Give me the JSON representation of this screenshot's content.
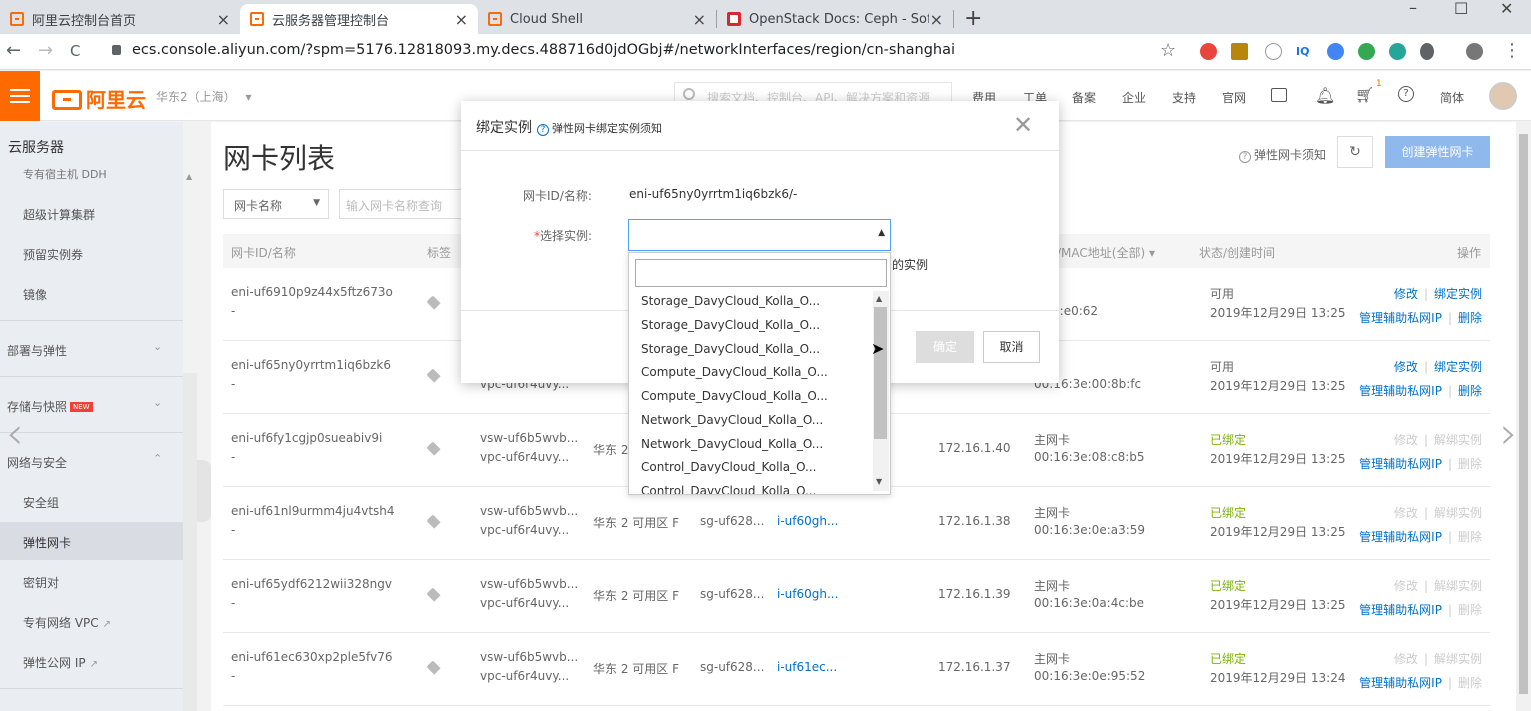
{
  "browser": {
    "tabs": [
      {
        "title": "阿里云控制台首页",
        "close": "×"
      },
      {
        "title": "云服务器管理控制台",
        "close": "×"
      },
      {
        "title": "Cloud Shell",
        "close": "×"
      },
      {
        "title": "OpenStack Docs: Ceph - Softw",
        "close": "×"
      }
    ],
    "new_tab": "+",
    "window_controls": {
      "minimize": "–",
      "maximize": "☐",
      "close": "✕"
    },
    "nav": {
      "back": "←",
      "forward": "→",
      "reload": "C"
    },
    "url": "ecs.console.aliyun.com/?spm=5176.12818093.my.decs.488716d0jdOGbj#/networkInterfaces/region/cn-shanghai",
    "star": "☆",
    "menu": "⋮"
  },
  "topbar": {
    "logo": "阿里云",
    "region": "华东2（上海）",
    "region_caret": "▾",
    "search_placeholder": "搜索文档、控制台、API、解决方案和资源",
    "links": [
      "费用",
      "工单",
      "备案",
      "企业",
      "支持",
      "官网"
    ],
    "cart_count": "1",
    "help": "?",
    "language": "简体"
  },
  "sidebar": {
    "title": "云服务器",
    "items_top": [
      "专有宿主机 DDH",
      "超级计算集群",
      "预留实例券",
      "镜像"
    ],
    "groups": [
      {
        "label": "部署与弹性",
        "chev": "⌄"
      },
      {
        "label": "存储与快照",
        "badge": "NEW",
        "chev": "⌄"
      },
      {
        "label": "网络与安全",
        "chev": "⌃"
      }
    ],
    "network_items": [
      "安全组",
      "弹性网卡",
      "密钥对",
      "专有网络 VPC",
      "弹性公网 IP"
    ],
    "up_arrow": "▲",
    "ext": "↗"
  },
  "main": {
    "title": "网卡列表",
    "help_link": "弹性网卡须知",
    "refresh": "↻",
    "create_button": "创建弹性网卡",
    "filter_select": "网卡名称",
    "filter_caret": "▼",
    "filter_placeholder": "输入网卡名称查询",
    "headers": {
      "id": "网卡ID/名称",
      "tag": "标签",
      "type_mac": "型/MAC地址(全部)",
      "type_caret": "▾",
      "status": "状态/创建时间",
      "ops": "操作"
    },
    "rows": [
      {
        "id": "eni-uf6910p9z44x5ftz673o",
        "name": "-",
        "vsw": "",
        "vpc": "",
        "zone": "",
        "sg": "",
        "inst": "",
        "ip": "",
        "type": "卡",
        "mac": "e:0c:e0:62",
        "status": "可用",
        "status_kind": "available",
        "time": "2019年12月29日 13:25",
        "op1": "修改",
        "op2": "绑定实例",
        "op3": "管理辅助私网IP",
        "op4": "删除"
      },
      {
        "id": "eni-uf65ny0yrrtm1iq6bzk6",
        "name": "-",
        "vsw": "",
        "vpc": "vpc-uf6r4uvy...",
        "zone": "",
        "sg": "",
        "inst": "",
        "ip": "",
        "type": "卡",
        "mac": "00:16:3e:00:8b:fc",
        "status": "可用",
        "status_kind": "available",
        "time": "2019年12月29日 13:25",
        "op1": "修改",
        "op2": "绑定实例",
        "op3": "管理辅助私网IP",
        "op4": "删除"
      },
      {
        "id": "eni-uf6fy1cgjp0sueabiv9i",
        "name": "-",
        "vsw": "vsw-uf6b5wvb...",
        "vpc": "vpc-uf6r4uvy...",
        "zone": "华东 2 可用",
        "sg": "",
        "inst": "",
        "ip": "172.16.1.40",
        "type": "主网卡",
        "mac": "00:16:3e:08:c8:b5",
        "status": "已绑定",
        "status_kind": "bound",
        "time": "2019年12月29日 13:25",
        "op1": "修改",
        "op2": "解绑实例",
        "op3": "管理辅助私网IP",
        "op4": "删除"
      },
      {
        "id": "eni-uf61nl9urmm4ju4vtsh4",
        "name": "-",
        "vsw": "vsw-uf6b5wvb...",
        "vpc": "vpc-uf6r4uvy...",
        "zone": "华东 2 可用区 F",
        "sg": "sg-uf628...",
        "inst": "i-uf60gh...",
        "ip": "172.16.1.38",
        "type": "主网卡",
        "mac": "00:16:3e:0e:a3:59",
        "status": "已绑定",
        "status_kind": "bound",
        "time": "2019年12月29日 13:25",
        "op1": "修改",
        "op2": "解绑实例",
        "op3": "管理辅助私网IP",
        "op4": "删除"
      },
      {
        "id": "eni-uf65ydf6212wii328ngv",
        "name": "-",
        "vsw": "vsw-uf6b5wvb...",
        "vpc": "vpc-uf6r4uvy...",
        "zone": "华东 2 可用区 F",
        "sg": "sg-uf628...",
        "inst": "i-uf60gh...",
        "ip": "172.16.1.39",
        "type": "主网卡",
        "mac": "00:16:3e:0a:4c:be",
        "status": "已绑定",
        "status_kind": "bound",
        "time": "2019年12月29日 13:25",
        "op1": "修改",
        "op2": "解绑实例",
        "op3": "管理辅助私网IP",
        "op4": "删除"
      },
      {
        "id": "eni-uf61ec630xp2ple5fv76",
        "name": "-",
        "vsw": "vsw-uf6b5wvb...",
        "vpc": "vpc-uf6r4uvy...",
        "zone": "华东 2 可用区 F",
        "sg": "sg-uf628...",
        "inst": "i-uf61ec...",
        "ip": "172.16.1.37",
        "type": "主网卡",
        "mac": "00:16:3e:0e:95:52",
        "status": "已绑定",
        "status_kind": "bound",
        "time": "2019年12月29日 13:24",
        "op1": "修改",
        "op2": "解绑实例",
        "op3": "管理辅助私网IP",
        "op4": "删除"
      }
    ],
    "sep": "|"
  },
  "modal": {
    "title": "绑定实例",
    "help_icon": "?",
    "help_text": "弹性网卡绑定实例须知",
    "close": "✕",
    "eni_label": "网卡ID/名称:",
    "eni_value": "eni-uf65ny0yrrtm1iq6bzk6/-",
    "instance_required_mark": "*",
    "instance_label": "选择实例:",
    "instance_value": "",
    "caret": "▲",
    "hint_suffix": "的实例",
    "ok": "确定",
    "cancel": "取消",
    "dropdown": {
      "search_value": "",
      "options": [
        "Storage_DavyCloud_Kolla_O...",
        "Storage_DavyCloud_Kolla_O...",
        "Storage_DavyCloud_Kolla_O...",
        "Compute_DavyCloud_Kolla_O...",
        "Compute_DavyCloud_Kolla_O...",
        "Network_DavyCloud_Kolla_O...",
        "Network_DavyCloud_Kolla_O...",
        "Control_DavyCloud_Kolla_O...",
        "Control_DavyCloud_Kolla_O..."
      ],
      "scroll_up": "▲",
      "scroll_down": "▼"
    }
  },
  "colors": {
    "accent": "#ff6a00",
    "link": "#0070cc",
    "bound": "#7cb305",
    "create_button": "#8fb8ed"
  }
}
